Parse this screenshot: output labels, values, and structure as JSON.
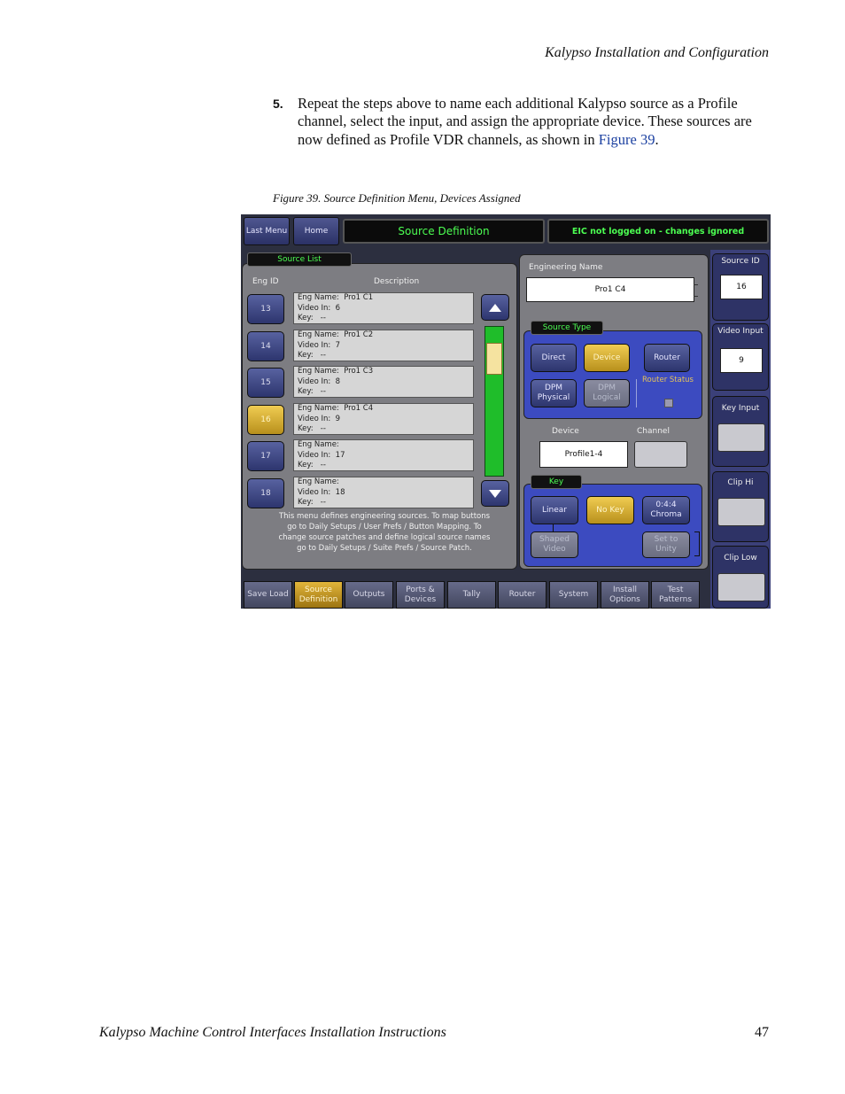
{
  "page": {
    "header": "Kalypso Installation and Configuration",
    "step_number": "5.",
    "step_text": "Repeat the steps above to name each additional Kalypso source as a Profile channel, select the input, and assign the appropriate device. These sources are now defined as Profile VDR channels, as shown in",
    "step_link": "Figure 39",
    "step_end": ".",
    "caption": "Figure 39.  Source Definition Menu, Devices Assigned",
    "footer_title": "Kalypso Machine Control Interfaces Installation Instructions",
    "footer_page": "47"
  },
  "ui": {
    "top_bar": {
      "last_menu": "Last Menu",
      "home": "Home",
      "title": "Source Definition",
      "status": "EIC not logged on - changes ignored"
    },
    "source_list": {
      "label": "Source List",
      "col_eng_id": "Eng ID",
      "col_description": "Description",
      "rows": [
        {
          "id": "13",
          "line1": "Eng Name:  Pro1 C1",
          "line2": "Video In:  6",
          "line3": "Key:   --",
          "selected": false
        },
        {
          "id": "14",
          "line1": "Eng Name:  Pro1 C2",
          "line2": "Video In:  7",
          "line3": "Key:   --",
          "selected": false
        },
        {
          "id": "15",
          "line1": "Eng Name:  Pro1 C3",
          "line2": "Video In:  8",
          "line3": "Key:   --",
          "selected": false
        },
        {
          "id": "16",
          "line1": "Eng Name:  Pro1 C4",
          "line2": "Video In:  9",
          "line3": "Key:   --",
          "selected": true
        },
        {
          "id": "17",
          "line1": "Eng Name:",
          "line2": "Video In:  17",
          "line3": "Key:   --",
          "selected": false
        },
        {
          "id": "18",
          "line1": "Eng Name:",
          "line2": "Video In:  18",
          "line3": "Key:   --",
          "selected": false
        }
      ],
      "help_text": "This menu defines engineering sources. To map buttons go to Daily Setups / User Prefs / Button Mapping. To change source patches and define logical source names go to Daily Setups / Suite Prefs / Source Patch."
    },
    "definition": {
      "eng_name_label": "Engineering Name",
      "eng_name_value": "Pro1 C4",
      "source_type_label": "Source Type",
      "direct": "Direct",
      "device": "Device",
      "router": "Router",
      "dpm_physical": "DPM Physical",
      "dpm_logical": "DPM Logical",
      "router_status": "Router Status",
      "device_label": "Device",
      "device_value": "Profile1-4",
      "channel_label": "Channel",
      "key_label": "Key",
      "linear": "Linear",
      "no_key": "No Key",
      "chroma": "0:4:4 Chroma",
      "shaped_video": "Shaped Video",
      "set_to_unity": "Set to Unity"
    },
    "side": {
      "source_id_label": "Source ID",
      "source_id_value": "16",
      "video_input_label": "Video Input",
      "video_input_value": "9",
      "key_input_label": "Key Input",
      "clip_hi_label": "Clip Hi",
      "clip_low_label": "Clip Low"
    },
    "bottom": {
      "save_load": "Save Load",
      "source_definition": "Source Definition",
      "outputs": "Outputs",
      "ports_devices": "Ports & Devices",
      "tally": "Tally",
      "router": "Router",
      "system": "System",
      "install_options": "Install Options",
      "test_patterns": "Test Patterns"
    },
    "colors": {
      "accent_green": "#4cff52",
      "selected_gold": "#e2b53a",
      "panel_blue": "#3c4bc0",
      "link_blue": "#1a3fa0"
    }
  }
}
